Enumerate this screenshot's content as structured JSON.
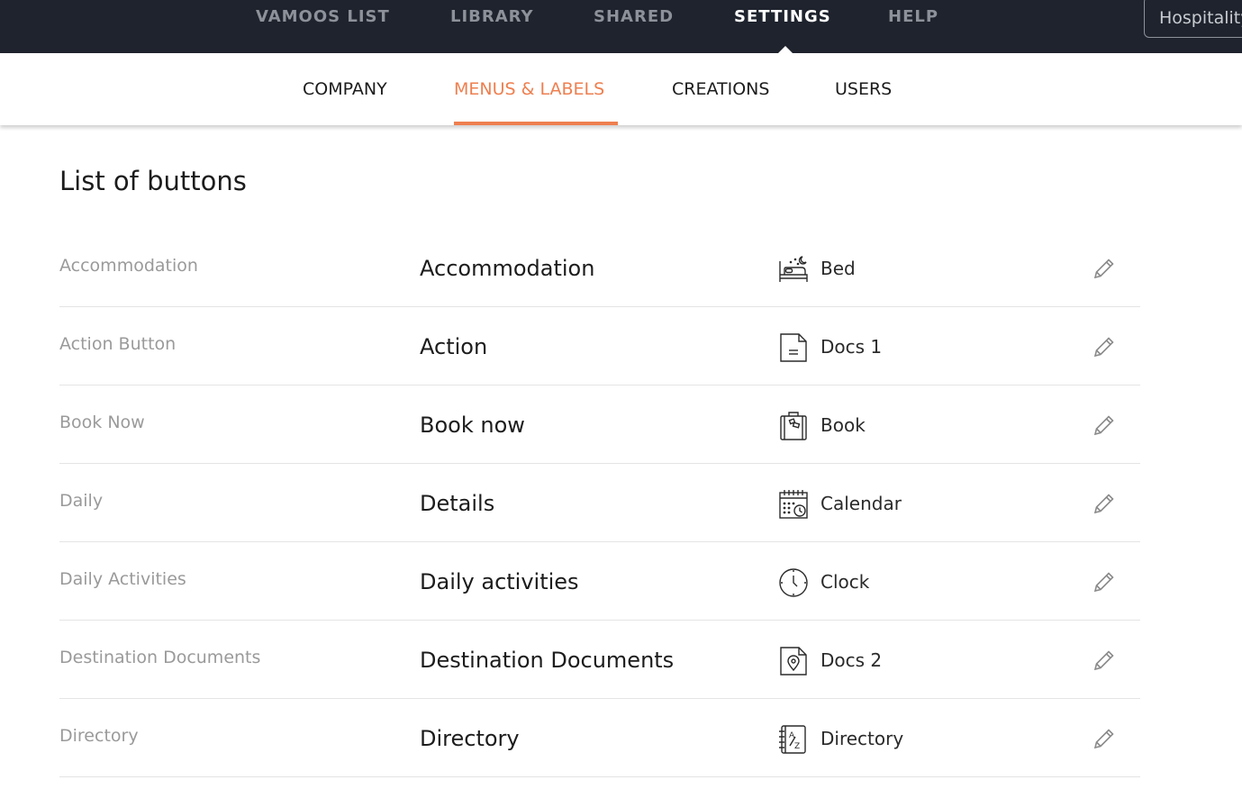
{
  "topnav": {
    "items": [
      {
        "label": "VAMOOS LIST",
        "active": false
      },
      {
        "label": "LIBRARY",
        "active": false
      },
      {
        "label": "SHARED",
        "active": false
      },
      {
        "label": "SETTINGS",
        "active": true
      },
      {
        "label": "HELP",
        "active": false
      }
    ],
    "operator_select": "Hospitality"
  },
  "subnav": {
    "items": [
      {
        "label": "COMPANY",
        "active": false
      },
      {
        "label": "MENUS & LABELS",
        "active": true
      },
      {
        "label": "CREATIONS",
        "active": false
      },
      {
        "label": "USERS",
        "active": false
      }
    ]
  },
  "main": {
    "title": "List of buttons",
    "rows": [
      {
        "key": "Accommodation",
        "label": "Accommodation",
        "icon": "bed-icon",
        "icon_name": "Bed"
      },
      {
        "key": "Action Button",
        "label": "Action",
        "icon": "document-icon",
        "icon_name": "Docs 1"
      },
      {
        "key": "Book Now",
        "label": "Book now",
        "icon": "luggage-icon",
        "icon_name": "Book"
      },
      {
        "key": "Daily",
        "label": "Details",
        "icon": "calendar-icon",
        "icon_name": "Calendar"
      },
      {
        "key": "Daily Activities",
        "label": "Daily activities",
        "icon": "clock-icon",
        "icon_name": "Clock"
      },
      {
        "key": "Destination Documents",
        "label": "Destination Documents",
        "icon": "location-document-icon",
        "icon_name": "Docs 2"
      },
      {
        "key": "Directory",
        "label": "Directory",
        "icon": "directory-book-icon",
        "icon_name": "Directory"
      }
    ]
  },
  "colors": {
    "topbar_bg": "#1e232d",
    "accent": "#ee7f4f",
    "muted_text": "#9a9a9a",
    "nav_inactive": "#8d9199"
  }
}
